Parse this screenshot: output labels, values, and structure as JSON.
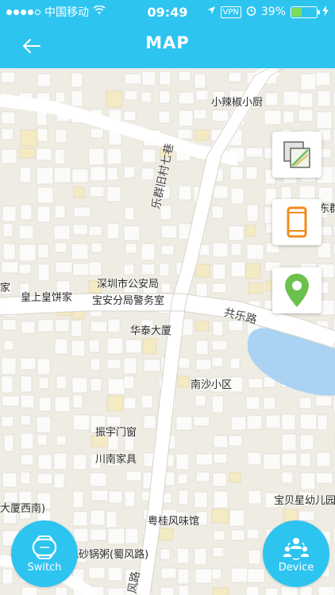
{
  "status_bar": {
    "carrier": "中国移动",
    "time": "09:49",
    "vpn": "VPN",
    "battery": "39%",
    "battery_level": 0.39
  },
  "header": {
    "title": "MAP",
    "back_icon": "back-arrow-icon"
  },
  "map": {
    "labels": {
      "restaurant_top": "小辣椒小厨",
      "cut_right": "东群",
      "cut_left": "家",
      "huangshang": "皇上皇饼家",
      "police1": "深圳市公安局",
      "police2": "宝安分局警务室",
      "huatai": "华泰大厦",
      "nansha": "南沙小区",
      "zhenyu": "振宇门窗",
      "chuannan": "川南家具",
      "dasha_xinan": "大厦西南)",
      "baobei": "宝贝星幼儿园",
      "yuegui": "粤桂风味馆",
      "zhouji": "记砂锅粥(蜀风路)"
    },
    "roads": {
      "lequn": "乐群旧村七巷",
      "gongle": "共乐路",
      "feng": "风路"
    }
  },
  "controls": {
    "layers_icon": "layers-icon",
    "phone_icon": "phone-icon",
    "location_icon": "map-pin-icon",
    "colors": {
      "phone": "#f08c1a",
      "pin": "#6cc14c"
    }
  },
  "bottom": {
    "switch_label": "Switch",
    "device_label": "Device",
    "switch_icon": "watch-icon",
    "device_icon": "people-icon"
  },
  "colors": {
    "brand": "#2ec4f0",
    "water": "#aad3f3"
  }
}
